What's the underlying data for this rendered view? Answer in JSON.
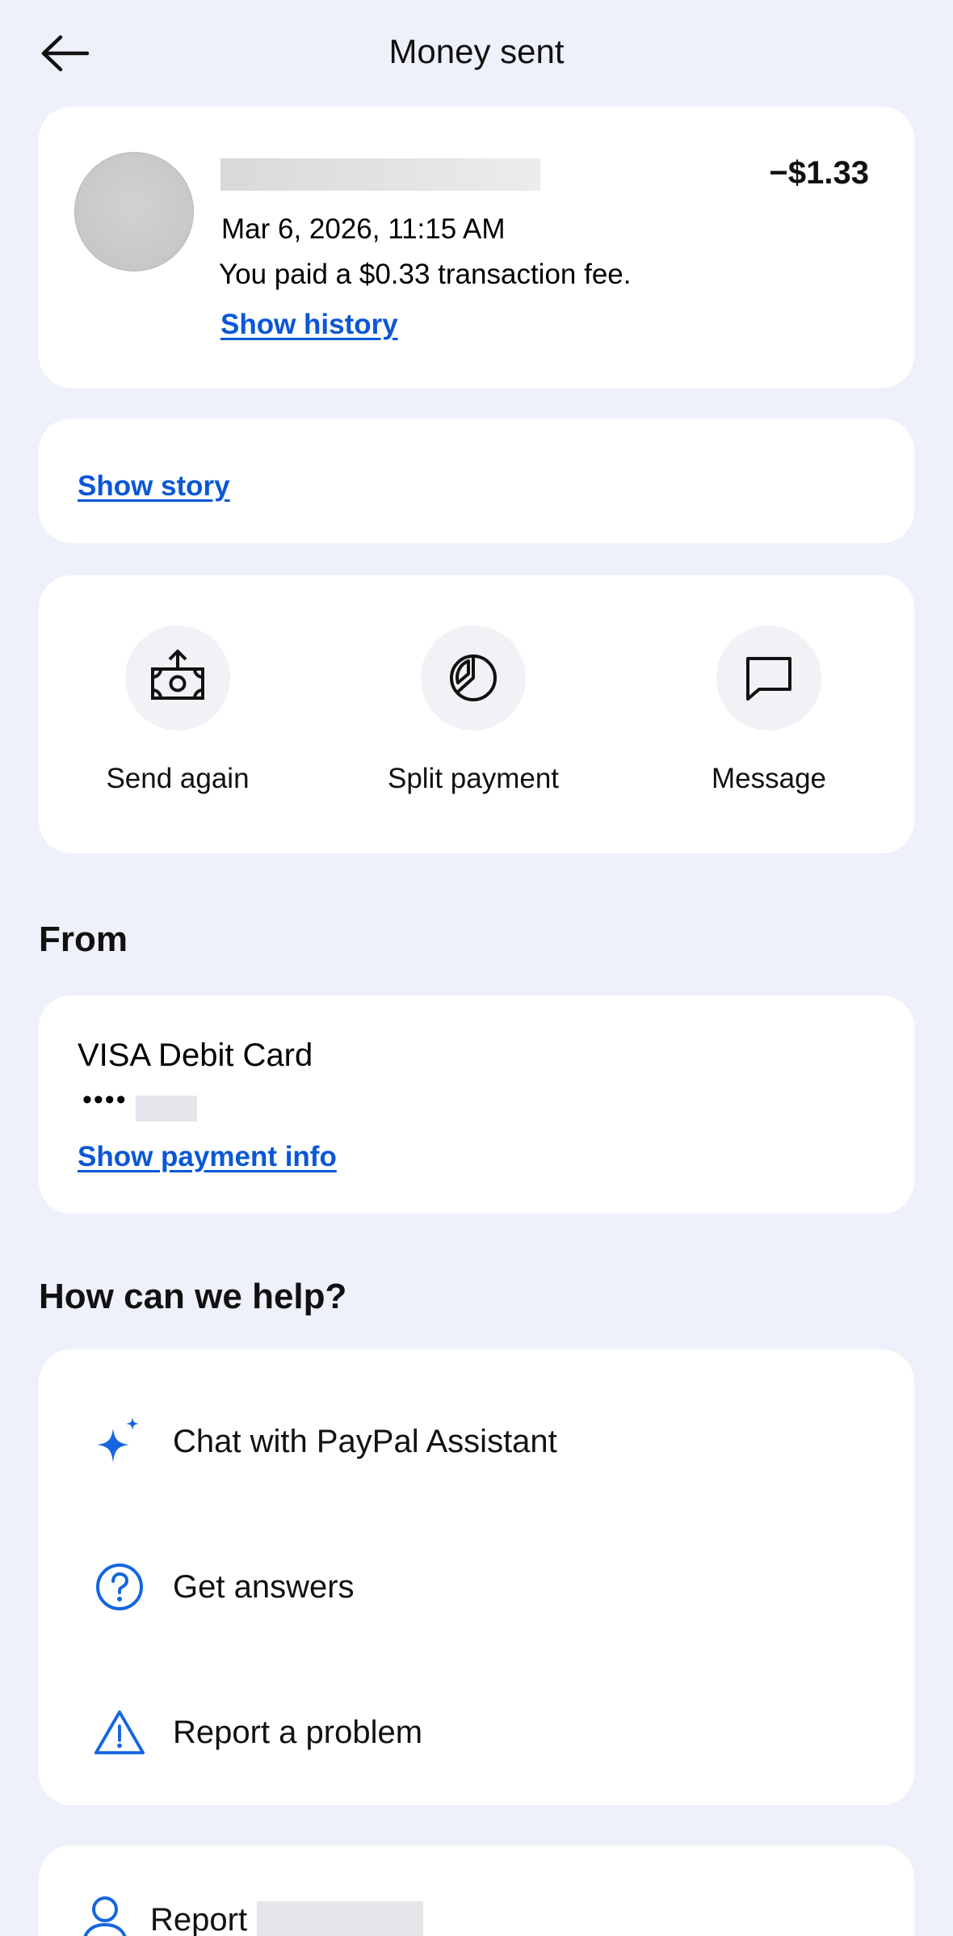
{
  "header": {
    "title": "Money sent",
    "back_icon": "arrow-left-icon"
  },
  "transaction": {
    "amount": "−$1.33",
    "date": "Mar 6, 2026, 11:15 AM",
    "fee_text": "You paid a $0.33 transaction fee.",
    "history_link": "Show history"
  },
  "story": {
    "link": "Show story"
  },
  "actions": [
    {
      "label": "Send again",
      "icon": "send-money-icon"
    },
    {
      "label": "Split payment",
      "icon": "pie-chart-icon"
    },
    {
      "label": "Message",
      "icon": "message-icon"
    }
  ],
  "from": {
    "heading": "From",
    "card_name": "VISA Debit Card",
    "card_mask": "••••",
    "payment_info_link": "Show payment info"
  },
  "help": {
    "heading": "How can we help?",
    "items": [
      {
        "label": "Chat with PayPal Assistant",
        "icon": "sparkle-icon"
      },
      {
        "label": "Get answers",
        "icon": "question-circle-icon"
      },
      {
        "label": "Report a problem",
        "icon": "warning-triangle-icon"
      }
    ]
  },
  "report_user": {
    "label": "Report",
    "icon": "person-icon"
  },
  "colors": {
    "background": "#eef1fa",
    "card": "#ffffff",
    "link": "#0a57d6",
    "accent_icon": "#1565e0"
  }
}
